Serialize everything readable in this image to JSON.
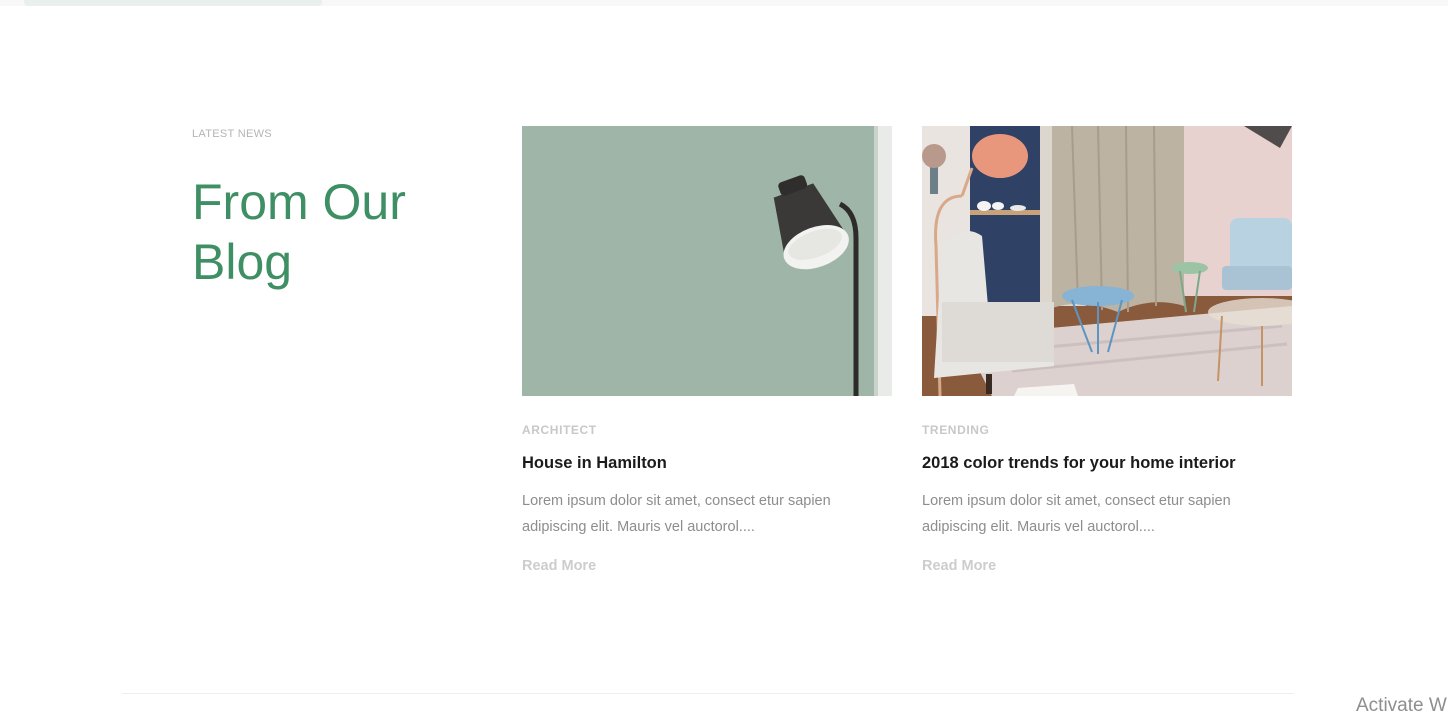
{
  "blog_section": {
    "eyebrow": "LATEST NEWS",
    "title": "From Our Blog",
    "accent_color": "#3f8f65"
  },
  "posts": [
    {
      "category": "ARCHITECT",
      "title": "House in Hamilton",
      "excerpt": "Lorem ipsum dolor sit amet, consect etur sapien adipiscing elit. Mauris vel auctorol....",
      "read_more": "Read More",
      "image": "lamp-on-sage-wall"
    },
    {
      "category": "TRENDING",
      "title": "2018 color trends for your home interior",
      "excerpt": "Lorem ipsum dolor sit amet, consect etur sapien adipiscing elit. Mauris vel auctorol....",
      "read_more": "Read More",
      "image": "pastel-living-room"
    }
  ],
  "os_overlay": {
    "watermark": "Activate W"
  }
}
